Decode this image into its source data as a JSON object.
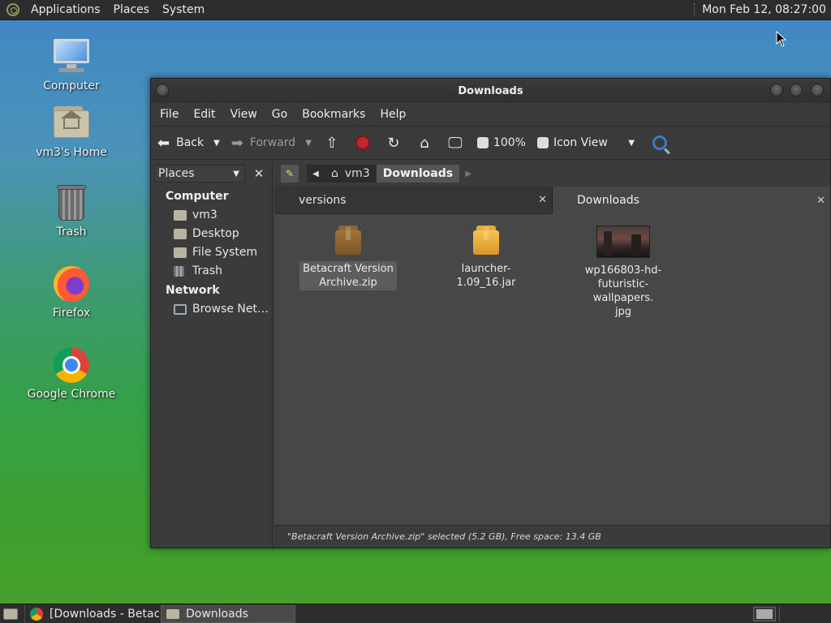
{
  "top_panel": {
    "menus": [
      "Applications",
      "Places",
      "System"
    ],
    "clock": "Mon Feb 12, 08:27:00"
  },
  "desktop_icons": [
    {
      "label": "Computer",
      "icon": "computer-icon"
    },
    {
      "label": "vm3's Home",
      "icon": "home-folder-icon"
    },
    {
      "label": "Trash",
      "icon": "trash-icon"
    },
    {
      "label": "Firefox",
      "icon": "firefox-icon"
    },
    {
      "label": "Google Chrome",
      "icon": "chrome-icon"
    }
  ],
  "window": {
    "title": "Downloads",
    "menu": [
      "File",
      "Edit",
      "View",
      "Go",
      "Bookmarks",
      "Help"
    ],
    "toolbar": {
      "back": "Back",
      "forward": "Forward",
      "zoom": "100%",
      "view_mode": "Icon View"
    },
    "sidebar": {
      "selector": "Places",
      "groups": [
        {
          "title": "Computer",
          "items": [
            "vm3",
            "Desktop",
            "File System",
            "Trash"
          ]
        },
        {
          "title": "Network",
          "items": [
            "Browse Net…"
          ]
        }
      ]
    },
    "pathbar": {
      "segments": [
        "vm3",
        "Downloads"
      ]
    },
    "tabs": [
      {
        "label": "versions",
        "active": false
      },
      {
        "label": "Downloads",
        "active": true
      }
    ],
    "files": [
      {
        "name_line1": "Betacraft Version",
        "name_line2": "Archive.zip",
        "name_line3": "",
        "type": "zip",
        "selected": true
      },
      {
        "name_line1": "launcher-1.09_16.jar",
        "name_line2": "",
        "name_line3": "",
        "type": "jar",
        "selected": false
      },
      {
        "name_line1": "wp166803-hd-",
        "name_line2": "futuristic-wallpapers.",
        "name_line3": "jpg",
        "type": "image",
        "selected": false
      }
    ],
    "status": "\"Betacraft Version Archive.zip\" selected (5.2 GB), Free space: 13.4 GB"
  },
  "taskbar": {
    "tasks": [
      {
        "label": "[Downloads - Betac…",
        "icon": "chrome-icon",
        "active": false
      },
      {
        "label": "Downloads",
        "icon": "folder-icon",
        "active": true
      }
    ]
  }
}
